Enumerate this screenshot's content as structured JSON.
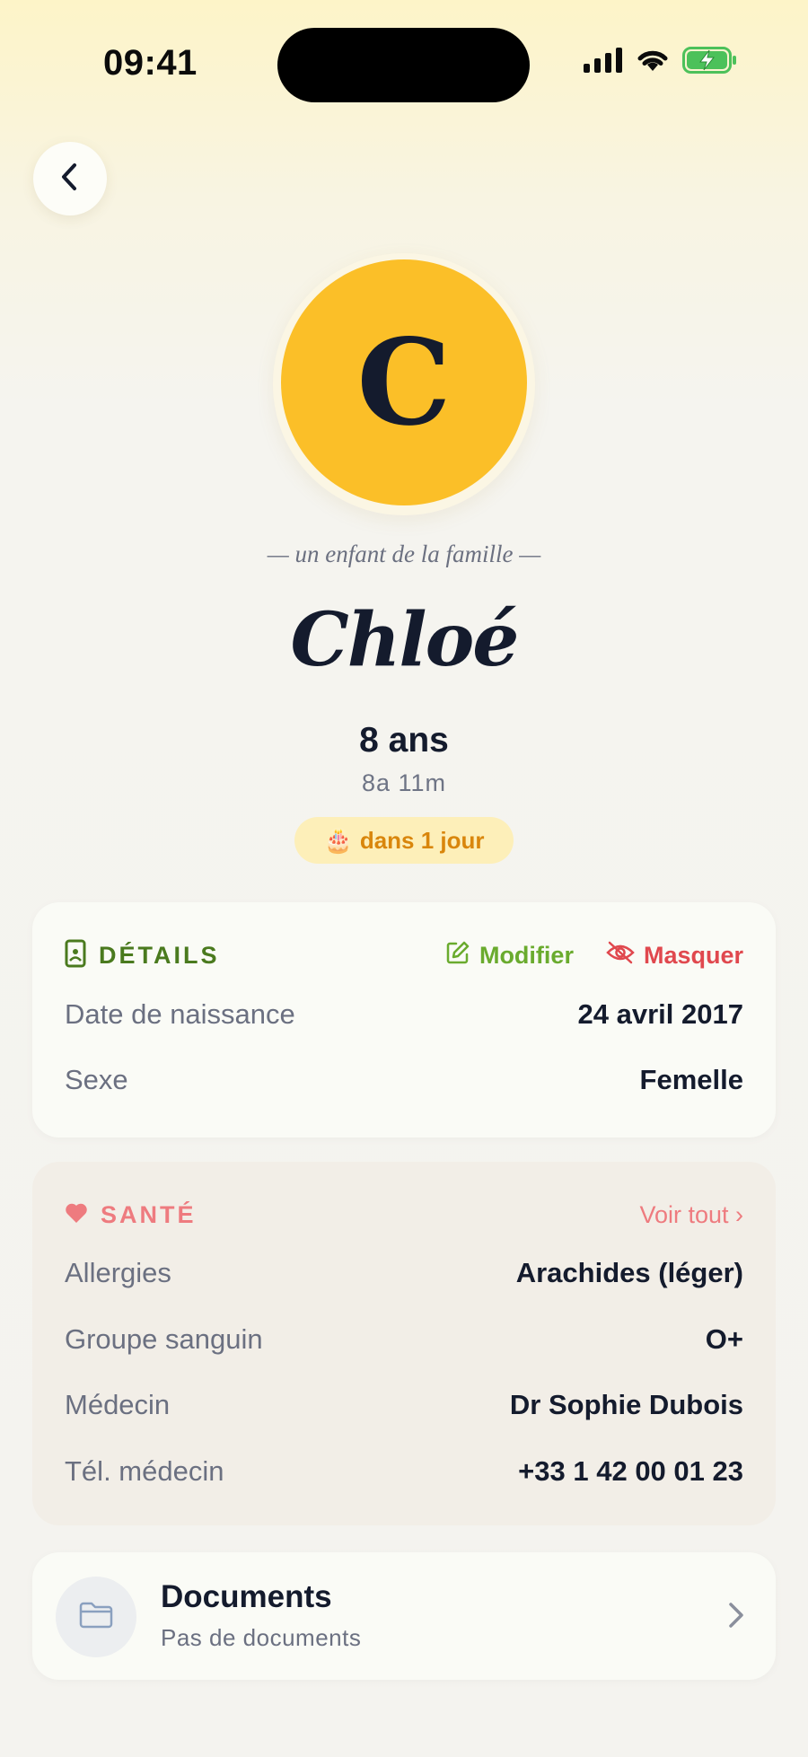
{
  "status_bar": {
    "time": "09:41"
  },
  "profile": {
    "avatar_letter": "C",
    "subtitle": "— un enfant de la famille —",
    "name": "Chloé",
    "age": "8 ans",
    "age_detail": "8a 11m",
    "birthday_emoji": "🎂",
    "birthday_text": "dans 1 jour"
  },
  "details": {
    "title": "DÉTAILS",
    "edit_label": "Modifier",
    "hide_label": "Masquer",
    "rows": [
      {
        "label": "Date de naissance",
        "value": "24 avril 2017"
      },
      {
        "label": "Sexe",
        "value": "Femelle"
      }
    ]
  },
  "health": {
    "title": "SANTÉ",
    "see_all_label": "Voir tout ›",
    "rows": [
      {
        "label": "Allergies",
        "value": "Arachides (léger)"
      },
      {
        "label": "Groupe sanguin",
        "value": "O+"
      },
      {
        "label": "Médecin",
        "value": "Dr Sophie Dubois"
      },
      {
        "label": "Tél. médecin",
        "value": "+33 1 42 00 01 23"
      }
    ]
  },
  "documents": {
    "title": "Documents",
    "subtitle": "Pas de documents"
  },
  "colors": {
    "avatar": "#fbbf28",
    "details_accent": "#4a7a1e",
    "edit_green": "#6aab2e",
    "hide_red": "#e0484e",
    "health_accent": "#ee7b7f",
    "birthday_text": "#d9860c",
    "birthday_bg": "#fdefb9"
  },
  "icons": {
    "back": "chevron-left-icon",
    "details": "phone-card-icon",
    "edit": "edit-icon",
    "hide": "eye-off-icon",
    "health": "heart-icon",
    "documents": "folder-icon",
    "documents_open": "chevron-right-icon"
  }
}
